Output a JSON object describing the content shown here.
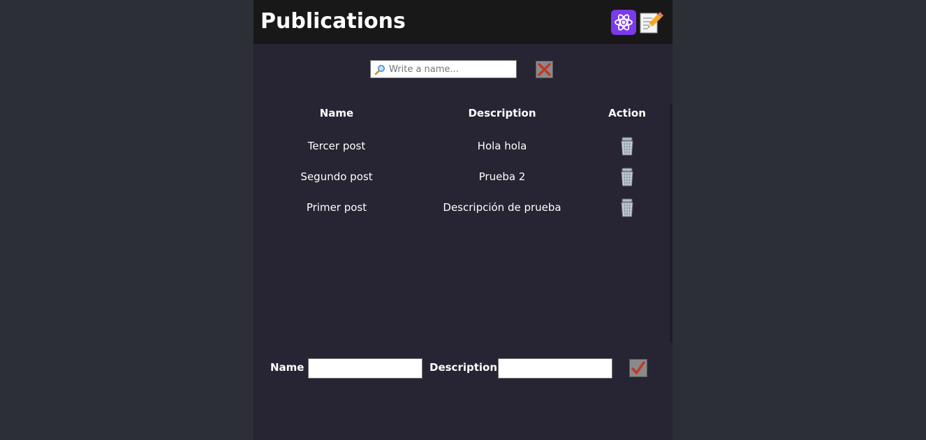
{
  "header": {
    "title": "Publications",
    "icons": [
      "atom-icon",
      "memo-icon"
    ]
  },
  "search": {
    "value": "",
    "placeholder": "Write a name...",
    "icon": "magnifier-icon",
    "clear_icon": "cross-mark-icon"
  },
  "table": {
    "headers": {
      "name": "Name",
      "description": "Description",
      "action": "Action"
    },
    "rows": [
      {
        "name": "Tercer post",
        "description": "Hola hola",
        "action_icon": "trash-icon"
      },
      {
        "name": "Segundo post",
        "description": "Prueba 2",
        "action_icon": "trash-icon"
      },
      {
        "name": "Primer post",
        "description": "Descripción de prueba",
        "action_icon": "trash-icon"
      }
    ]
  },
  "form": {
    "name_label": "Name",
    "name_value": "",
    "description_label": "Description",
    "description_value": "",
    "submit_icon": "check-mark-icon"
  },
  "colors": {
    "page_background": "#2c2f36",
    "app_background": "#272433",
    "header_background": "#181818",
    "react_logo_background": "#7c3aed",
    "clear_icon": "#c0392b",
    "check_icon": "#c0392b"
  }
}
